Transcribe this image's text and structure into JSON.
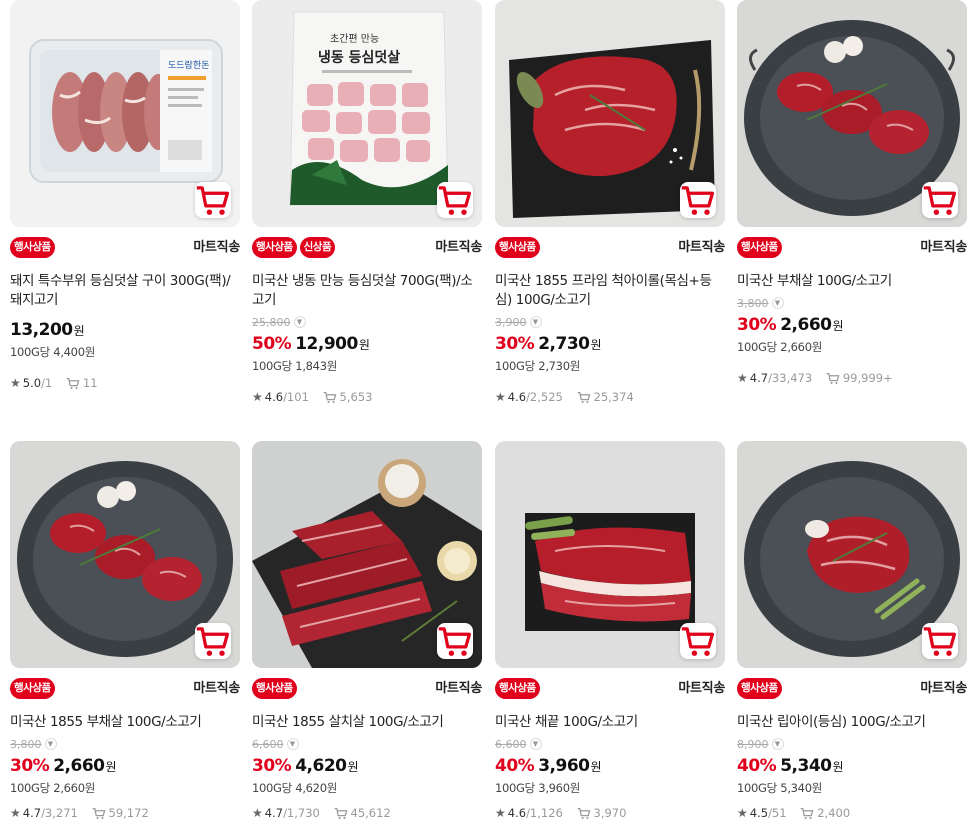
{
  "products": [
    {
      "badges": [
        "행사상품"
      ],
      "shipping": "마트직송",
      "title": "돼지 특수부위 등심덧살 구이 300G(팩)/돼지고기",
      "original_price": "",
      "discount": "",
      "price": "13,200",
      "won": "원",
      "unit_price": "100G당 4,400원",
      "rating": "5.0",
      "reviews": "/1",
      "cart_count": "11"
    },
    {
      "badges": [
        "행사상품",
        "신상품"
      ],
      "shipping": "마트직송",
      "title": "미국산 냉동 만능 등심덧살 700G(팩)/소고기",
      "original_price": "25,800",
      "discount": "50%",
      "price": "12,900",
      "won": "원",
      "unit_price": "100G당 1,843원",
      "rating": "4.6",
      "reviews": "/101",
      "cart_count": "5,653"
    },
    {
      "badges": [
        "행사상품"
      ],
      "shipping": "마트직송",
      "title": "미국산 1855 프라임 척아이롤(목심+등심) 100G/소고기",
      "original_price": "3,900",
      "discount": "30%",
      "price": "2,730",
      "won": "원",
      "unit_price": "100G당 2,730원",
      "rating": "4.6",
      "reviews": "/2,525",
      "cart_count": "25,374"
    },
    {
      "badges": [
        "행사상품"
      ],
      "shipping": "마트직송",
      "title": "미국산 부채살 100G/소고기",
      "original_price": "3,800",
      "discount": "30%",
      "price": "2,660",
      "won": "원",
      "unit_price": "100G당 2,660원",
      "rating": "4.7",
      "reviews": "/33,473",
      "cart_count": "99,999+"
    },
    {
      "badges": [
        "행사상품"
      ],
      "shipping": "마트직송",
      "title": "미국산 1855 부채살 100G/소고기",
      "original_price": "3,800",
      "discount": "30%",
      "price": "2,660",
      "won": "원",
      "unit_price": "100G당 2,660원",
      "rating": "4.7",
      "reviews": "/3,271",
      "cart_count": "59,172"
    },
    {
      "badges": [
        "행사상품"
      ],
      "shipping": "마트직송",
      "title": "미국산 1855 살치살 100G/소고기",
      "original_price": "6,600",
      "discount": "30%",
      "price": "4,620",
      "won": "원",
      "unit_price": "100G당 4,620원",
      "rating": "4.7",
      "reviews": "/1,730",
      "cart_count": "45,612"
    },
    {
      "badges": [
        "행사상품"
      ],
      "shipping": "마트직송",
      "title": "미국산 채끝 100G/소고기",
      "original_price": "6,600",
      "discount": "40%",
      "price": "3,960",
      "won": "원",
      "unit_price": "100G당 3,960원",
      "rating": "4.6",
      "reviews": "/1,126",
      "cart_count": "3,970"
    },
    {
      "badges": [
        "행사상품"
      ],
      "shipping": "마트직송",
      "title": "미국산 립아이(등심) 100G/소고기",
      "original_price": "8,900",
      "discount": "40%",
      "price": "5,340",
      "won": "원",
      "unit_price": "100G당 5,340원",
      "rating": "4.5",
      "reviews": "/51",
      "cart_count": "2,400"
    }
  ],
  "package_labels": {
    "p1": "도드람한돈",
    "p2_top": "초간편 만능",
    "p2_main": "냉동 등심덧살"
  },
  "colors": {
    "accent": "#e0001b",
    "text": "#111111",
    "muted": "#888888"
  },
  "icons": {
    "cart": "cart-icon",
    "star": "star-icon",
    "chevron": "chevron-down-icon"
  }
}
